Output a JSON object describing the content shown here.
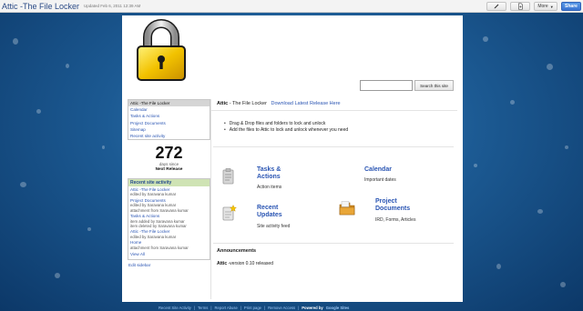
{
  "header": {
    "site_title": "Attic -The File Locker",
    "updated": "Updated Feb 6, 2011 12:39 AM",
    "more_label": "More",
    "share_label": "Share",
    "pencil_icon": "pencil-icon",
    "newpage_icon": "new-page-icon"
  },
  "search": {
    "placeholder": "",
    "button_label": "Search this site"
  },
  "sidebar": {
    "nav": [
      {
        "label": "Attic -The File Locker"
      },
      {
        "label": "Calendar"
      },
      {
        "label": "Tasks & Actions"
      },
      {
        "label": "Project Documents"
      },
      {
        "label": "Sitemap"
      },
      {
        "label": "Recent site activity"
      }
    ],
    "countdown": {
      "number": "272",
      "sub": "days since",
      "label": "Next Release"
    },
    "activity": {
      "heading": "Recent site activity",
      "items": [
        {
          "title": "Attic -The File Locker",
          "lines": [
            "edited by Saravana kumar"
          ]
        },
        {
          "title": "Project Documents",
          "lines": [
            "edited by Saravana kumar",
            "attachment from Saravana kumar"
          ]
        },
        {
          "title": "Tasks & Actions",
          "lines": [
            "item added by Saravana kumar",
            "item deleted by Saravana kumar"
          ]
        },
        {
          "title": "Attic -The File Locker",
          "lines": [
            "edited by Saravana kumar"
          ]
        },
        {
          "title": "Home",
          "lines": [
            "attachment from Saravana kumar"
          ]
        }
      ],
      "view_all": "View All"
    },
    "edit_sidebar": "Edit sidebar"
  },
  "main": {
    "title_bold": "Attic",
    "title_rest": " - The File Locker",
    "download_link": "Download Latest Release Here",
    "bullets": [
      "Drag & Drop files and folders to lock and unlock",
      "Add the files to Attic to lock and unlock whenever you need"
    ],
    "blocks": {
      "tasks": {
        "title_1": "Tasks &",
        "title_2": "Actions",
        "desc": "Action items"
      },
      "calendar": {
        "title": "Calendar",
        "desc": "Important dates"
      },
      "updates": {
        "title_1": "Recent",
        "title_2": "Updates",
        "desc": "Site activity feed"
      },
      "docs": {
        "title_1": "Project",
        "title_2": "Documents",
        "desc": "IRD, Forms, Articles"
      }
    },
    "announcements": {
      "heading": "Announcements",
      "item_bold": "Attic",
      "item_rest": " -version 0.10 released"
    }
  },
  "footer": {
    "links": [
      "Recent Site Activity",
      "Terms",
      "Report Abuse",
      "Print page",
      "Remove Access"
    ],
    "powered_prefix": "Powered by",
    "powered_brand": "Google Sites"
  },
  "colors": {
    "link": "#2a55b3",
    "activity_header": "#cfe3b4",
    "background": "#1c5a93",
    "share_button": "#3a74d0",
    "lock_body": "#f2c200"
  }
}
